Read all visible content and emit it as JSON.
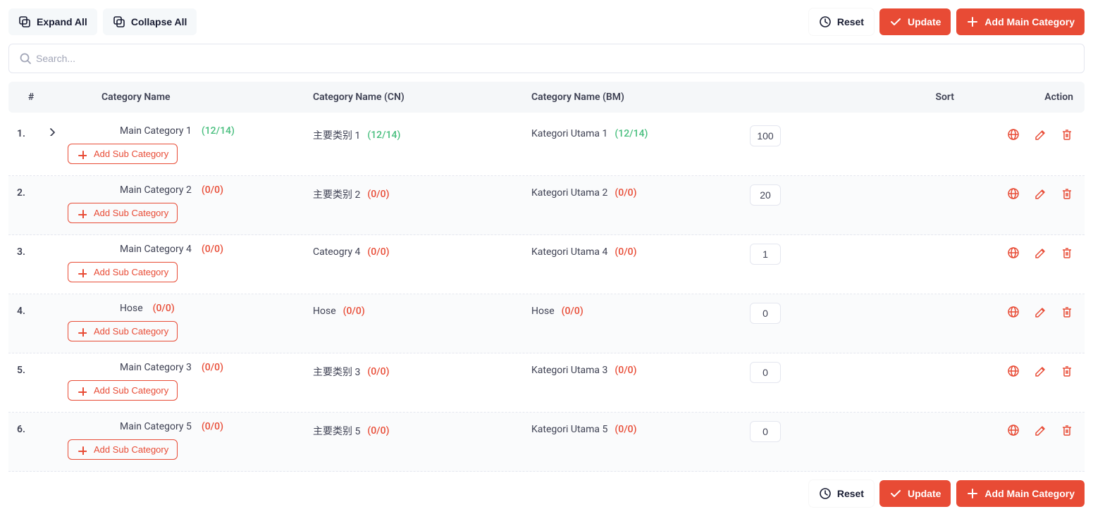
{
  "toolbar": {
    "expand_all": "Expand All",
    "collapse_all": "Collapse All",
    "reset": "Reset",
    "update": "Update",
    "add_main": "Add Main Category"
  },
  "search": {
    "placeholder": "Search..."
  },
  "headers": {
    "num": "#",
    "name": "Category Name",
    "cn": "Category Name (CN)",
    "bm": "Category Name (BM)",
    "sort": "Sort",
    "action": "Action"
  },
  "add_sub_label": "Add Sub Category",
  "rows": [
    {
      "num": "1.",
      "expandable": true,
      "name": "Main Category 1",
      "name_counts": "(12/14)",
      "cn": "主要类别 1",
      "cn_counts": "(12/14)",
      "bm": "Kategori Utama 1",
      "bm_counts": "(12/14)",
      "sort": "100",
      "counts_style": "green"
    },
    {
      "num": "2.",
      "expandable": false,
      "name": "Main Category 2",
      "name_counts": "(0/0)",
      "cn": "主要类别 2",
      "cn_counts": "(0/0)",
      "bm": "Kategori Utama 2",
      "bm_counts": "(0/0)",
      "sort": "20",
      "counts_style": "red"
    },
    {
      "num": "3.",
      "expandable": false,
      "name": "Main Category 4",
      "name_counts": "(0/0)",
      "cn": "Cateogry 4",
      "cn_counts": "(0/0)",
      "bm": "Kategori Utama 4",
      "bm_counts": "(0/0)",
      "sort": "1",
      "counts_style": "red"
    },
    {
      "num": "4.",
      "expandable": false,
      "name": "Hose",
      "name_counts": "(0/0)",
      "cn": "Hose",
      "cn_counts": "(0/0)",
      "bm": "Hose",
      "bm_counts": "(0/0)",
      "sort": "0",
      "counts_style": "red"
    },
    {
      "num": "5.",
      "expandable": false,
      "name": "Main Category 3",
      "name_counts": "(0/0)",
      "cn": "主要类别 3",
      "cn_counts": "(0/0)",
      "bm": "Kategori Utama 3",
      "bm_counts": "(0/0)",
      "sort": "0",
      "counts_style": "red"
    },
    {
      "num": "6.",
      "expandable": false,
      "name": "Main Category 5",
      "name_counts": "(0/0)",
      "cn": "主要类别 5",
      "cn_counts": "(0/0)",
      "bm": "Kategori Utama 5",
      "bm_counts": "(0/0)",
      "sort": "0",
      "counts_style": "red"
    }
  ]
}
